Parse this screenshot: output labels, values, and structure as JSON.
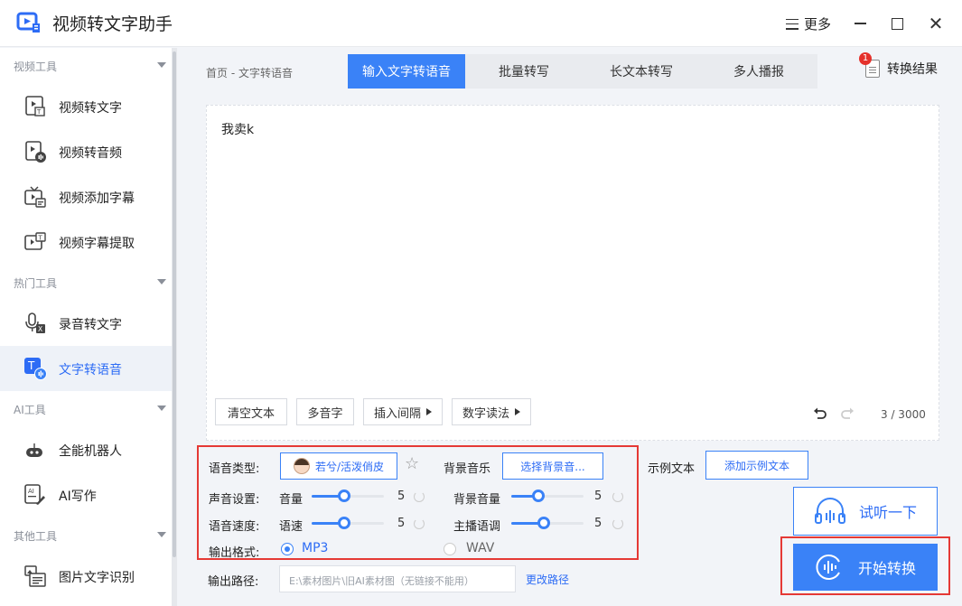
{
  "app": {
    "title": "视频转文字助手",
    "more_label": "更多"
  },
  "sidebar": {
    "categories": [
      {
        "label": "视频工具",
        "items": [
          "视频转文字",
          "视频转音频",
          "视频添加字幕",
          "视频字幕提取"
        ]
      },
      {
        "label": "热门工具",
        "items": [
          "录音转文字",
          "文字转语音"
        ]
      },
      {
        "label": "AI工具",
        "items": [
          "全能机器人",
          "AI写作"
        ]
      },
      {
        "label": "其他工具",
        "items": [
          "图片文字识别"
        ]
      }
    ],
    "active_item": "文字转语音"
  },
  "breadcrumb": "首页 - 文字转语音",
  "tabs": [
    "输入文字转语音",
    "批量转写",
    "长文本转写",
    "多人播报"
  ],
  "active_tab": "输入文字转语音",
  "result": {
    "label": "转换结果",
    "badge": "1"
  },
  "editor": {
    "text": "我卖k",
    "buttons": [
      "清空文本",
      "多音字",
      "插入间隔",
      "数字读法"
    ],
    "char_count": "3 / 3000"
  },
  "settings": {
    "voice_type_label": "语音类型:",
    "voice_name": "若兮/活泼俏皮",
    "bgm_label": "背景音乐",
    "bgm_button": "选择背景音...",
    "sound_label": "声音设置:",
    "volume_label": "音量",
    "volume_value": "5",
    "bg_volume_label": "背景音量",
    "bg_volume_value": "5",
    "speed_section_label": "语音速度:",
    "speed_label": "语速",
    "speed_value": "5",
    "pitch_label": "主播语调",
    "pitch_value": "5",
    "format_label": "输出格式:",
    "format_options": [
      "MP3",
      "WAV"
    ],
    "selected_format": "MP3",
    "slider_levels": {
      "volume": 0.45,
      "bg_volume": 0.38,
      "speed": 0.45,
      "pitch": 0.45
    }
  },
  "example": {
    "label": "示例文本",
    "button": "添加示例文本"
  },
  "output": {
    "label": "输出路径:",
    "path": "E:\\素材图片\\旧AI素材图（无链接不能用）",
    "change_label": "更改路径"
  },
  "actions": {
    "listen": "试听一下",
    "start": "开始转换"
  },
  "colors": {
    "accent": "#3a82f7",
    "highlight": "#e53935",
    "badge": "#e5312b"
  }
}
